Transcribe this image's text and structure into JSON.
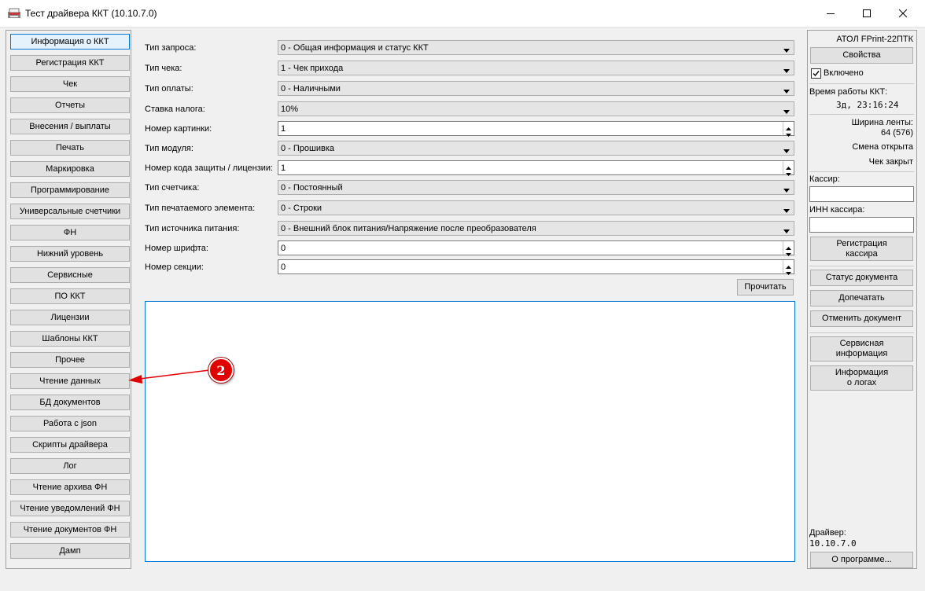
{
  "window": {
    "title": "Тест драйвера ККТ (10.10.7.0)",
    "icons": [
      "app-icon",
      "minimize-icon",
      "maximize-icon",
      "close-icon"
    ]
  },
  "nav": {
    "items": [
      "Информация о ККТ",
      "Регистрация ККТ",
      "Чек",
      "Отчеты",
      "Внесения / выплаты",
      "Печать",
      "Маркировка",
      "Программирование",
      "Универсальные счетчики",
      "ФН",
      "Нижний уровень",
      "Сервисные",
      "ПО ККТ",
      "Лицензии",
      "Шаблоны ККТ",
      "Прочее",
      "Чтение данных",
      "БД документов",
      "Работа с json",
      "Скрипты драйвера",
      "Лог",
      "Чтение архива ФН",
      "Чтение уведомлений ФН",
      "Чтение документов ФН",
      "Дамп"
    ],
    "active_index": 0
  },
  "form": {
    "fields": [
      {
        "label": "Тип запроса:",
        "type": "combo",
        "value": "0 - Общая информация и статус ККТ"
      },
      {
        "label": "Тип чека:",
        "type": "combo",
        "value": "1 - Чек прихода"
      },
      {
        "label": "Тип оплаты:",
        "type": "combo",
        "value": "0 - Наличными"
      },
      {
        "label": "Ставка налога:",
        "type": "combo",
        "value": "10%"
      },
      {
        "label": "Номер картинки:",
        "type": "spin",
        "value": "1"
      },
      {
        "label": "Тип модуля:",
        "type": "combo",
        "value": "0 - Прошивка"
      },
      {
        "label": "Номер кода защиты / лицензии:",
        "type": "spin",
        "value": "1"
      },
      {
        "label": "Тип счетчика:",
        "type": "combo",
        "value": "0 - Постоянный"
      },
      {
        "label": "Тип печатаемого элемента:",
        "type": "combo",
        "value": "0 - Строки"
      },
      {
        "label": "Тип источника питания:",
        "type": "combo",
        "value": "0 - Внешний блок питания/Напряжение после преобразователя"
      },
      {
        "label": "Номер шрифта:",
        "type": "spin",
        "value": "0"
      },
      {
        "label": "Номер секции:",
        "type": "spin",
        "value": "0"
      }
    ],
    "read_button": "Прочитать"
  },
  "annotation": {
    "number": "2",
    "color": "#e00000"
  },
  "right": {
    "device_name": "АТОЛ FPrint-22ПТК",
    "properties_button": "Свойства",
    "enabled_label": "Включено",
    "enabled_checked": true,
    "uptime_label": "Время работы ККТ:",
    "uptime_value": "3д, 23:16:24",
    "tape_width_label": "Ширина ленты:",
    "tape_width_value": "64 (576)",
    "shift_status": "Смена открыта",
    "receipt_status": "Чек закрыт",
    "cashier_label": "Кассир:",
    "cashier_value": "",
    "cashier_inn_label": "ИНН кассира:",
    "cashier_inn_value": "",
    "register_cashier_button": [
      "Регистрация",
      "кассира"
    ],
    "doc_status_button": "Статус документа",
    "reprint_button": "Допечатать",
    "cancel_doc_button": "Отменить документ",
    "service_info_button": [
      "Сервисная",
      "информация"
    ],
    "logs_info_button": [
      "Информация",
      "о логах"
    ],
    "driver_label": "Драйвер:",
    "driver_version": "10.10.7.0",
    "about_button": "О программе..."
  },
  "colors": {
    "accent": "#0078d7",
    "annotation": "#e00000"
  }
}
